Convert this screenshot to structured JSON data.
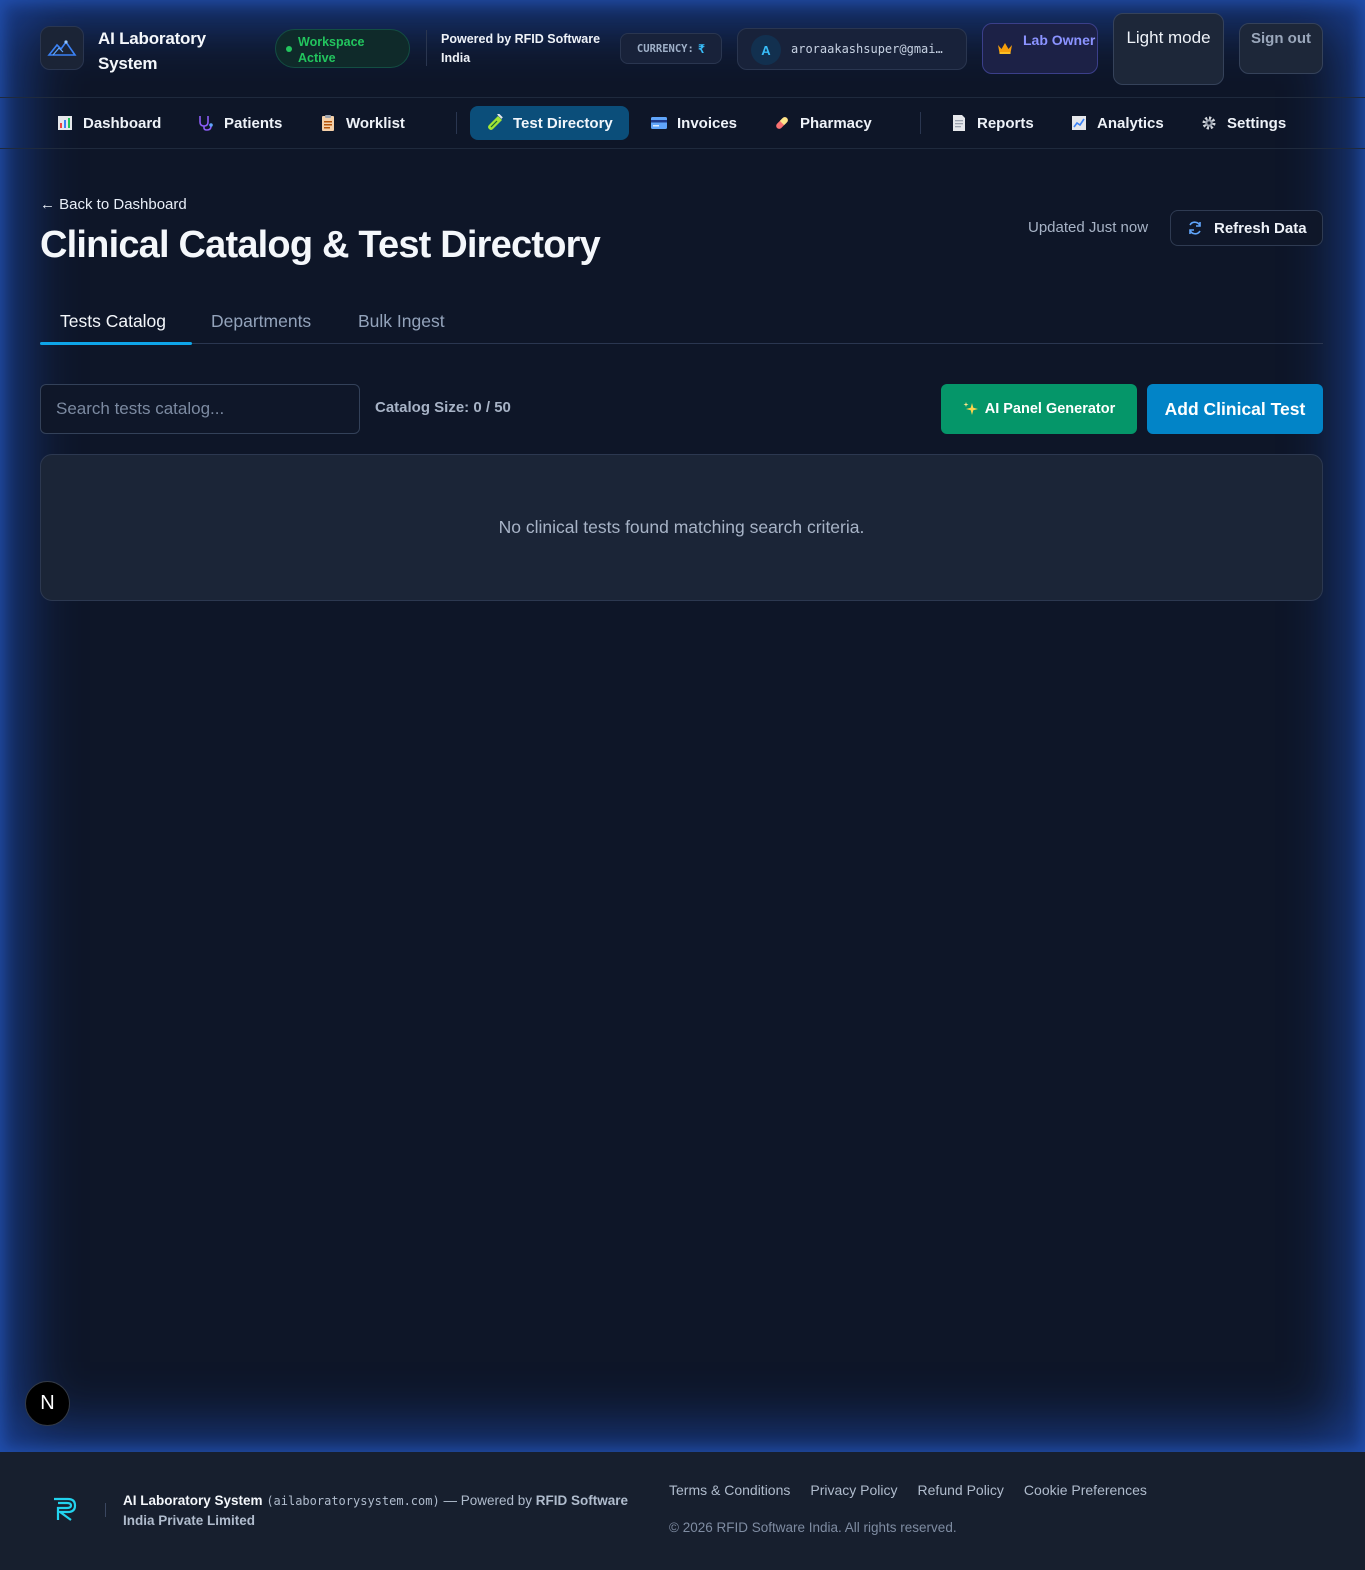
{
  "header": {
    "brand": "AI Laboratory System",
    "workspace_status": "Workspace Active",
    "powered_by": "Powered by RFID Software India",
    "currency_label": "CURRENCY:",
    "currency_symbol": "₹",
    "user_initial": "A",
    "user_email": "aroraakashsuper@gmai…",
    "role": "Lab Owner",
    "theme_button": "Light mode",
    "signout_button": "Sign out"
  },
  "nav": {
    "items": [
      {
        "label": "Dashboard",
        "icon": "bar-chart-icon"
      },
      {
        "label": "Patients",
        "icon": "stethoscope-icon"
      },
      {
        "label": "Worklist",
        "icon": "clipboard-icon"
      },
      {
        "label": "Test Directory",
        "icon": "test-tube-icon",
        "active": true
      },
      {
        "label": "Invoices",
        "icon": "credit-card-icon"
      },
      {
        "label": "Pharmacy",
        "icon": "pill-icon"
      },
      {
        "label": "Reports",
        "icon": "document-icon"
      },
      {
        "label": "Analytics",
        "icon": "trend-chart-icon"
      },
      {
        "label": "Settings",
        "icon": "gear-icon"
      }
    ]
  },
  "page": {
    "back_link": "← Back to Dashboard",
    "title": "Clinical Catalog & Test Directory",
    "updated": "Updated Just now",
    "refresh_button": "Refresh Data"
  },
  "tabs": [
    "Tests Catalog",
    "Departments",
    "Bulk Ingest"
  ],
  "toolbar": {
    "search_placeholder": "Search tests catalog...",
    "catalog_size": "Catalog Size: 0 / 50",
    "ai_button": "AI Panel Generator",
    "add_button": "Add Clinical Test"
  },
  "empty_state": "No clinical tests found matching search criteria.",
  "dev_badge": "N",
  "footer": {
    "brand": "AI Laboratory System",
    "domain": "(ailaboratorysystem.com)",
    "powered_prefix": "— Powered by",
    "company": "RFID Software India Private Limited",
    "links": [
      "Terms & Conditions",
      "Privacy Policy",
      "Refund Policy",
      "Cookie Preferences"
    ],
    "copyright": "© 2026 RFID Software India. All rights reserved."
  },
  "colors": {
    "background": "#0e1628",
    "accent_blue": "#0284c7",
    "accent_green": "#059669",
    "active_nav": "#0b4e7a",
    "role_purple": "#8b93ff"
  }
}
